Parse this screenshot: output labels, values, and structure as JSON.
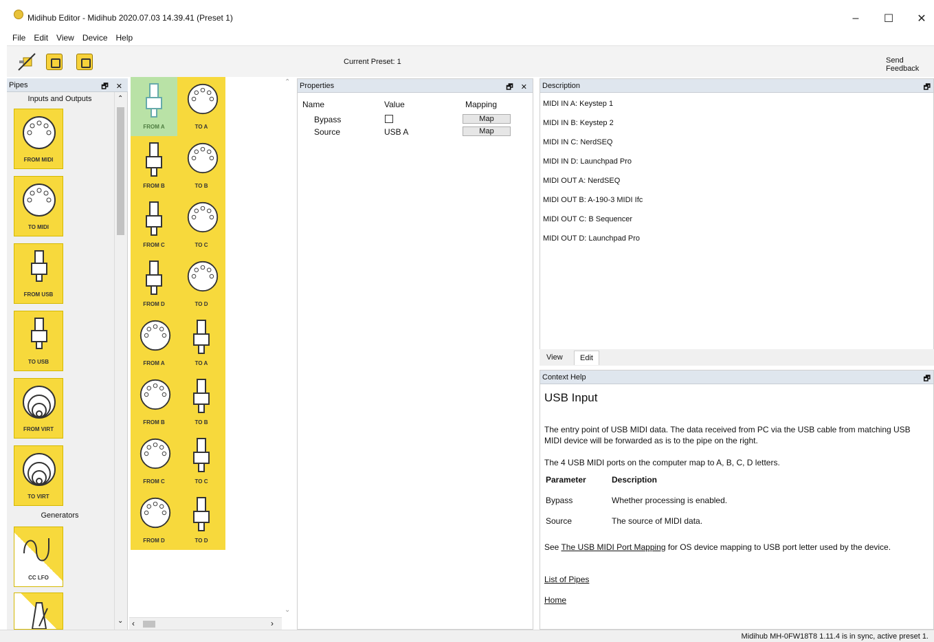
{
  "window": {
    "title": "Midihub Editor - Midihub 2020.07.03 14.39.41 (Preset 1)",
    "min": "–",
    "max": "☐",
    "close": "✕"
  },
  "menu": [
    "File",
    "Edit",
    "View",
    "Device",
    "Help"
  ],
  "toolbar": {
    "current_preset": "Current Preset: 1",
    "send_feedback": "Send Feedback"
  },
  "pipes": {
    "title": "Pipes",
    "ctrls": "🗗 ✕",
    "sections": {
      "io": "Inputs and Outputs",
      "gen": "Generators"
    },
    "tiles": [
      "FROM MIDI",
      "TO MIDI",
      "FROM USB",
      "TO USB",
      "FROM VIRT",
      "TO VIRT",
      "CC LFO"
    ]
  },
  "grid": {
    "cells": [
      "FROM A",
      "TO A",
      "FROM B",
      "TO B",
      "FROM C",
      "TO C",
      "FROM D",
      "TO D",
      "FROM A",
      "TO A",
      "FROM B",
      "TO B",
      "FROM C",
      "TO C",
      "FROM D",
      "TO D"
    ]
  },
  "properties": {
    "title": "Properties",
    "ctrls": "🗗 ✕",
    "headers": {
      "name": "Name",
      "value": "Value",
      "mapping": "Mapping"
    },
    "rows": [
      {
        "name": "Bypass",
        "value": "",
        "map": "Map"
      },
      {
        "name": "Source",
        "value": "USB A",
        "map": "Map"
      }
    ]
  },
  "description": {
    "title": "Description",
    "lines": [
      "MIDI IN A: Keystep 1",
      "MIDI IN B: Keystep 2",
      "MIDI IN C: NerdSEQ",
      "MIDI IN D: Launchpad Pro",
      "MIDI OUT A: NerdSEQ",
      "MIDI OUT B: A-190-3 MIDI Ifc",
      "MIDI OUT C: B Sequencer",
      "MIDI OUT D: Launchpad Pro"
    ],
    "tabs": [
      "View",
      "Edit"
    ]
  },
  "context": {
    "title": "Context Help",
    "heading": "USB Input",
    "p1": "The entry point of USB MIDI data. The data received from PC via the USB cable from matching USB MIDI device will be forwarded as is to the pipe on the right.",
    "p2": "The 4 USB MIDI ports on the computer map to A, B, C, D letters.",
    "table_head": {
      "param": "Parameter",
      "desc": "Description"
    },
    "table_rows": [
      {
        "param": "Bypass",
        "desc": "Whether processing is enabled."
      },
      {
        "param": "Source",
        "desc": "The source of MIDI data."
      }
    ],
    "see_prefix": "See ",
    "see_link": "The USB MIDI Port Mapping",
    "see_suffix": " for OS device mapping to USB port letter used by the device.",
    "link_pipes": "List of Pipes",
    "link_home": "Home"
  },
  "status": "Midihub MH-0FW18T8 1.11.4 is in sync, active preset 1."
}
